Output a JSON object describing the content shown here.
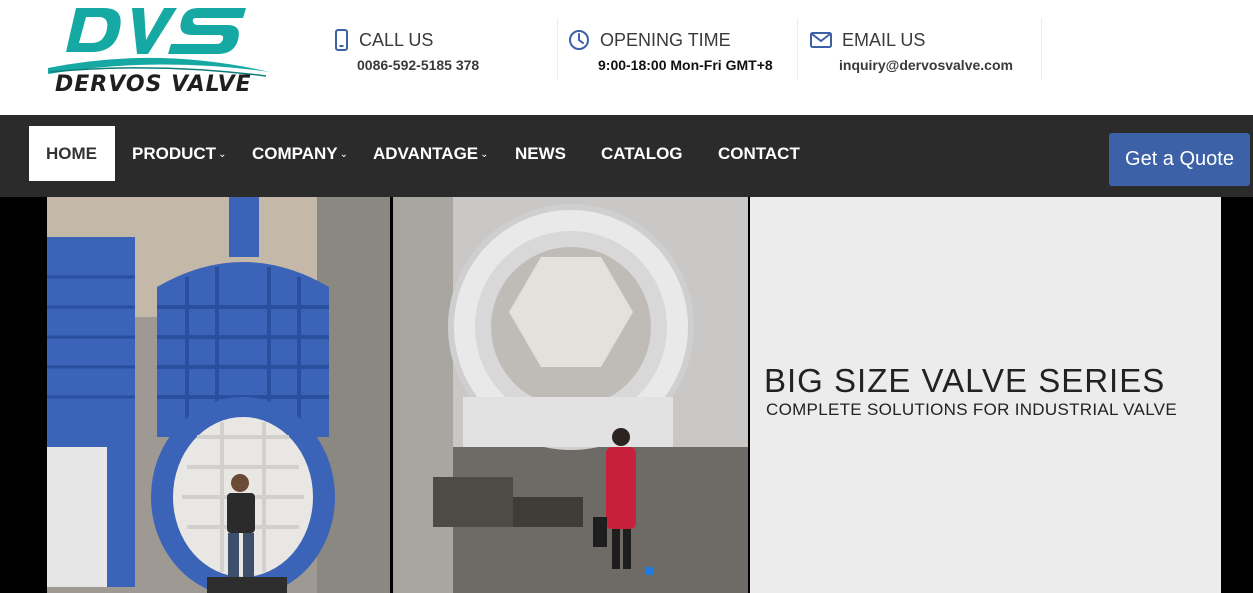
{
  "brand": {
    "logo_mark": "DVS",
    "name": "DERVOS VALVE",
    "colors": {
      "teal": "#16a9a3",
      "dark": "#1f1f1f"
    }
  },
  "header": {
    "call": {
      "icon": "phone-icon",
      "label": "CALL US",
      "value": "0086-592-5185 378"
    },
    "opening": {
      "icon": "clock-icon",
      "label": "OPENING TIME",
      "value": "9:00-18:00 Mon-Fri GMT+8"
    },
    "email": {
      "icon": "mail-icon",
      "label": "EMAIL US",
      "value": "inquiry@dervosvalve.com"
    },
    "icon_color": "#3d61a7"
  },
  "nav": {
    "items": [
      {
        "label": "HOME",
        "active": true
      },
      {
        "label": "PRODUCT",
        "dropdown": true
      },
      {
        "label": "COMPANY",
        "dropdown": true
      },
      {
        "label": "ADVANTAGE",
        "dropdown": true
      },
      {
        "label": "NEWS"
      },
      {
        "label": "CATALOG"
      },
      {
        "label": "CONTACT"
      }
    ],
    "quote_label": "Get a Quote",
    "bg_color": "#2b2b2b",
    "quote_color": "#3d61a7"
  },
  "banner": {
    "title": "BIG SIZE VALVE SERIES",
    "subtitle": "COMPLETE SOLUTIONS FOR INDUSTRIAL VALVE",
    "indicator_color": "#1e7be2"
  }
}
